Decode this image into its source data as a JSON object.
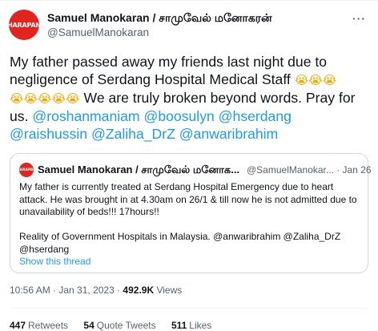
{
  "author": {
    "avatar_text": "HARAPAN",
    "name": "Samuel Manokaran / சாமுவேல் மனோகரன்",
    "handle": "@SamuelManokaran"
  },
  "more_icon": "more-icon",
  "tweet": {
    "text_1": "My father passed away my friends last night due to negligence of Serdang Hospital Medical Staff ",
    "emoji_line_1": "😭😭😭",
    "emoji_line_2": "😭😭😭😭😭",
    "text_2": " We are truly broken beyond words. Pray for us. ",
    "mentions": [
      "@roshanmaniam",
      "@boosulyn",
      "@hserdang",
      "@raishussin",
      "@Zaliha_DrZ",
      "@anwaribrahim"
    ]
  },
  "quote": {
    "avatar_text": "HARAPAN",
    "name": "Samuel Manokaran / சாமுவேல் மனோக...",
    "handle_date": "@SamuelManokar... · Jan 26",
    "para_1": "My father is currently treated at Serdang Hospital Emergency due to heart attack. He was brought in at 4.30am on 26/1 & till now he is not admitted due to unavailability of beds!!! 17hours!!",
    "para_2": "Reality of Government Hospitals in Malaysia. @anwaribrahim @Zaliha_DrZ @hserdang",
    "show_thread": "Show this thread"
  },
  "meta": {
    "time_date": "10:56 AM · Jan 31, 2023 · ",
    "views_count": "492.9K",
    "views_label": " Views"
  },
  "stats": {
    "retweets_count": "447",
    "retweets_label": "Retweets",
    "quotes_count": "54",
    "quotes_label": "Quote Tweets",
    "likes_count": "511",
    "likes_label": "Likes"
  }
}
